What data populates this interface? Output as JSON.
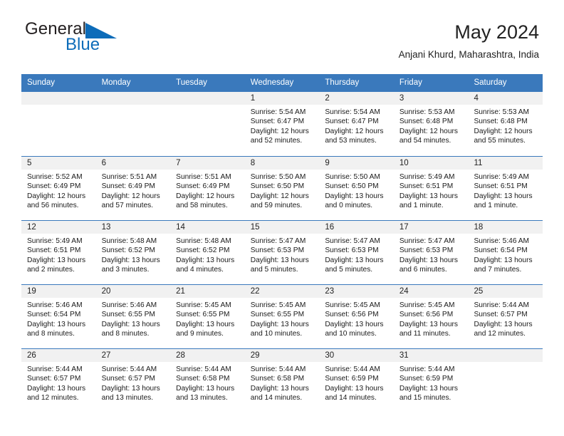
{
  "brand": {
    "name_part1": "General",
    "name_part2": "Blue",
    "triangle_color": "#0d6cb9",
    "text_color": "#231f20"
  },
  "header": {
    "title": "May 2024",
    "subtitle": "Anjani Khurd, Maharashtra, India"
  },
  "colors": {
    "header_blue": "#3a79bc",
    "day_band_gray": "#f1f1f1",
    "accent_blue": "#0d6cb9"
  },
  "weekdays": [
    "Sunday",
    "Monday",
    "Tuesday",
    "Wednesday",
    "Thursday",
    "Friday",
    "Saturday"
  ],
  "weeks": [
    [
      {
        "day": "",
        "sunrise": "",
        "sunset": "",
        "daylight1": "",
        "daylight2": ""
      },
      {
        "day": "",
        "sunrise": "",
        "sunset": "",
        "daylight1": "",
        "daylight2": ""
      },
      {
        "day": "",
        "sunrise": "",
        "sunset": "",
        "daylight1": "",
        "daylight2": ""
      },
      {
        "day": "1",
        "sunrise": "Sunrise: 5:54 AM",
        "sunset": "Sunset: 6:47 PM",
        "daylight1": "Daylight: 12 hours",
        "daylight2": "and 52 minutes."
      },
      {
        "day": "2",
        "sunrise": "Sunrise: 5:54 AM",
        "sunset": "Sunset: 6:47 PM",
        "daylight1": "Daylight: 12 hours",
        "daylight2": "and 53 minutes."
      },
      {
        "day": "3",
        "sunrise": "Sunrise: 5:53 AM",
        "sunset": "Sunset: 6:48 PM",
        "daylight1": "Daylight: 12 hours",
        "daylight2": "and 54 minutes."
      },
      {
        "day": "4",
        "sunrise": "Sunrise: 5:53 AM",
        "sunset": "Sunset: 6:48 PM",
        "daylight1": "Daylight: 12 hours",
        "daylight2": "and 55 minutes."
      }
    ],
    [
      {
        "day": "5",
        "sunrise": "Sunrise: 5:52 AM",
        "sunset": "Sunset: 6:49 PM",
        "daylight1": "Daylight: 12 hours",
        "daylight2": "and 56 minutes."
      },
      {
        "day": "6",
        "sunrise": "Sunrise: 5:51 AM",
        "sunset": "Sunset: 6:49 PM",
        "daylight1": "Daylight: 12 hours",
        "daylight2": "and 57 minutes."
      },
      {
        "day": "7",
        "sunrise": "Sunrise: 5:51 AM",
        "sunset": "Sunset: 6:49 PM",
        "daylight1": "Daylight: 12 hours",
        "daylight2": "and 58 minutes."
      },
      {
        "day": "8",
        "sunrise": "Sunrise: 5:50 AM",
        "sunset": "Sunset: 6:50 PM",
        "daylight1": "Daylight: 12 hours",
        "daylight2": "and 59 minutes."
      },
      {
        "day": "9",
        "sunrise": "Sunrise: 5:50 AM",
        "sunset": "Sunset: 6:50 PM",
        "daylight1": "Daylight: 13 hours",
        "daylight2": "and 0 minutes."
      },
      {
        "day": "10",
        "sunrise": "Sunrise: 5:49 AM",
        "sunset": "Sunset: 6:51 PM",
        "daylight1": "Daylight: 13 hours",
        "daylight2": "and 1 minute."
      },
      {
        "day": "11",
        "sunrise": "Sunrise: 5:49 AM",
        "sunset": "Sunset: 6:51 PM",
        "daylight1": "Daylight: 13 hours",
        "daylight2": "and 1 minute."
      }
    ],
    [
      {
        "day": "12",
        "sunrise": "Sunrise: 5:49 AM",
        "sunset": "Sunset: 6:51 PM",
        "daylight1": "Daylight: 13 hours",
        "daylight2": "and 2 minutes."
      },
      {
        "day": "13",
        "sunrise": "Sunrise: 5:48 AM",
        "sunset": "Sunset: 6:52 PM",
        "daylight1": "Daylight: 13 hours",
        "daylight2": "and 3 minutes."
      },
      {
        "day": "14",
        "sunrise": "Sunrise: 5:48 AM",
        "sunset": "Sunset: 6:52 PM",
        "daylight1": "Daylight: 13 hours",
        "daylight2": "and 4 minutes."
      },
      {
        "day": "15",
        "sunrise": "Sunrise: 5:47 AM",
        "sunset": "Sunset: 6:53 PM",
        "daylight1": "Daylight: 13 hours",
        "daylight2": "and 5 minutes."
      },
      {
        "day": "16",
        "sunrise": "Sunrise: 5:47 AM",
        "sunset": "Sunset: 6:53 PM",
        "daylight1": "Daylight: 13 hours",
        "daylight2": "and 5 minutes."
      },
      {
        "day": "17",
        "sunrise": "Sunrise: 5:47 AM",
        "sunset": "Sunset: 6:53 PM",
        "daylight1": "Daylight: 13 hours",
        "daylight2": "and 6 minutes."
      },
      {
        "day": "18",
        "sunrise": "Sunrise: 5:46 AM",
        "sunset": "Sunset: 6:54 PM",
        "daylight1": "Daylight: 13 hours",
        "daylight2": "and 7 minutes."
      }
    ],
    [
      {
        "day": "19",
        "sunrise": "Sunrise: 5:46 AM",
        "sunset": "Sunset: 6:54 PM",
        "daylight1": "Daylight: 13 hours",
        "daylight2": "and 8 minutes."
      },
      {
        "day": "20",
        "sunrise": "Sunrise: 5:46 AM",
        "sunset": "Sunset: 6:55 PM",
        "daylight1": "Daylight: 13 hours",
        "daylight2": "and 8 minutes."
      },
      {
        "day": "21",
        "sunrise": "Sunrise: 5:45 AM",
        "sunset": "Sunset: 6:55 PM",
        "daylight1": "Daylight: 13 hours",
        "daylight2": "and 9 minutes."
      },
      {
        "day": "22",
        "sunrise": "Sunrise: 5:45 AM",
        "sunset": "Sunset: 6:55 PM",
        "daylight1": "Daylight: 13 hours",
        "daylight2": "and 10 minutes."
      },
      {
        "day": "23",
        "sunrise": "Sunrise: 5:45 AM",
        "sunset": "Sunset: 6:56 PM",
        "daylight1": "Daylight: 13 hours",
        "daylight2": "and 10 minutes."
      },
      {
        "day": "24",
        "sunrise": "Sunrise: 5:45 AM",
        "sunset": "Sunset: 6:56 PM",
        "daylight1": "Daylight: 13 hours",
        "daylight2": "and 11 minutes."
      },
      {
        "day": "25",
        "sunrise": "Sunrise: 5:44 AM",
        "sunset": "Sunset: 6:57 PM",
        "daylight1": "Daylight: 13 hours",
        "daylight2": "and 12 minutes."
      }
    ],
    [
      {
        "day": "26",
        "sunrise": "Sunrise: 5:44 AM",
        "sunset": "Sunset: 6:57 PM",
        "daylight1": "Daylight: 13 hours",
        "daylight2": "and 12 minutes."
      },
      {
        "day": "27",
        "sunrise": "Sunrise: 5:44 AM",
        "sunset": "Sunset: 6:57 PM",
        "daylight1": "Daylight: 13 hours",
        "daylight2": "and 13 minutes."
      },
      {
        "day": "28",
        "sunrise": "Sunrise: 5:44 AM",
        "sunset": "Sunset: 6:58 PM",
        "daylight1": "Daylight: 13 hours",
        "daylight2": "and 13 minutes."
      },
      {
        "day": "29",
        "sunrise": "Sunrise: 5:44 AM",
        "sunset": "Sunset: 6:58 PM",
        "daylight1": "Daylight: 13 hours",
        "daylight2": "and 14 minutes."
      },
      {
        "day": "30",
        "sunrise": "Sunrise: 5:44 AM",
        "sunset": "Sunset: 6:59 PM",
        "daylight1": "Daylight: 13 hours",
        "daylight2": "and 14 minutes."
      },
      {
        "day": "31",
        "sunrise": "Sunrise: 5:44 AM",
        "sunset": "Sunset: 6:59 PM",
        "daylight1": "Daylight: 13 hours",
        "daylight2": "and 15 minutes."
      },
      {
        "day": "",
        "sunrise": "",
        "sunset": "",
        "daylight1": "",
        "daylight2": ""
      }
    ]
  ]
}
